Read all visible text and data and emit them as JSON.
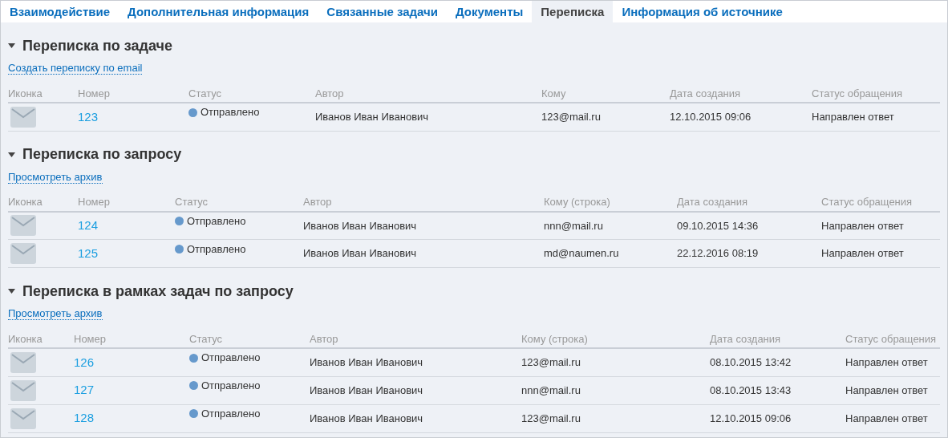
{
  "tabs": [
    {
      "label": "Взаимодействие",
      "selected": false
    },
    {
      "label": "Дополнительная информация",
      "selected": false
    },
    {
      "label": "Связанные задачи",
      "selected": false
    },
    {
      "label": "Документы",
      "selected": false
    },
    {
      "label": "Переписка",
      "selected": true
    },
    {
      "label": "Информация об источнике",
      "selected": false
    }
  ],
  "sections": [
    {
      "title": "Переписка по задаче",
      "expanded": true,
      "link": "Создать переписку по email",
      "columns": [
        "Иконка",
        "Номер",
        "Статус",
        "Автор",
        "Кому",
        "Дата создания",
        "Статус обращения"
      ],
      "rows": [
        {
          "number": "123",
          "status": "Отправлено",
          "color": "#6699cc",
          "author": "Иванов Иван Иванович",
          "to": "123@mail.ru",
          "date": "12.10.2015 09:06",
          "appeal_status": "Направлен ответ"
        }
      ]
    },
    {
      "title": "Переписка по запросу",
      "expanded": true,
      "link": "Просмотреть архив",
      "columns": [
        "Иконка",
        "Номер",
        "Статус",
        "Автор",
        "Кому (строка)",
        "Дата создания",
        "Статус обращения"
      ],
      "rows": [
        {
          "number": "124",
          "status": "Отправлено",
          "color": "#6699cc",
          "author": "Иванов Иван Иванович",
          "to": "nnn@mail.ru",
          "date": "09.10.2015 14:36",
          "appeal_status": "Направлен ответ"
        },
        {
          "number": "125",
          "status": "Отправлено",
          "color": "#6699cc",
          "author": "Иванов Иван Иванович",
          "to": "md@naumen.ru",
          "date": "22.12.2016 08:19",
          "appeal_status": "Направлен ответ"
        }
      ]
    },
    {
      "title": "Переписка в рамках задач по запросу",
      "expanded": true,
      "link": "Просмотреть архив",
      "columns": [
        "Иконка",
        "Номер",
        "Статус",
        "Автор",
        "Кому (строка)",
        "Дата создания",
        "Статус обращения"
      ],
      "rows": [
        {
          "number": "126",
          "status": "Отправлено",
          "color": "#6699cc",
          "author": "Иванов Иван Иванович",
          "to": "123@mail.ru",
          "date": "08.10.2015 13:42",
          "appeal_status": "Направлен ответ"
        },
        {
          "number": "127",
          "status": "Отправлено",
          "color": "#6699cc",
          "author": "Иванов Иван Иванович",
          "to": "nnn@mail.ru",
          "date": "08.10.2015 13:43",
          "appeal_status": "Направлен ответ"
        },
        {
          "number": "128",
          "status": "Отправлено",
          "color": "#6699cc",
          "author": "Иванов Иван Иванович",
          "to": "123@mail.ru",
          "date": "12.10.2015 09:06",
          "appeal_status": "Направлен ответ"
        }
      ]
    }
  ]
}
